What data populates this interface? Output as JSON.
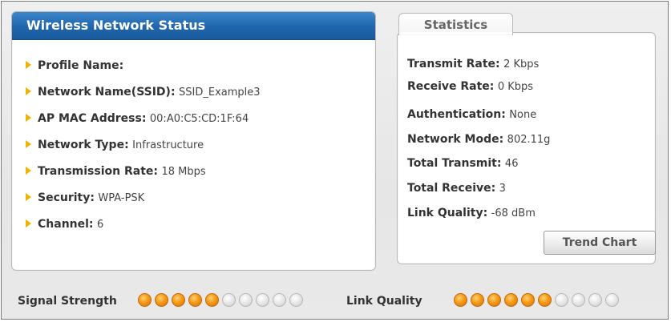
{
  "status": {
    "title": "Wireless Network Status",
    "items": [
      {
        "key": "Profile Name:",
        "value": ""
      },
      {
        "key": "Network Name(SSID):",
        "value": "SSID_Example3"
      },
      {
        "key": "AP MAC Address:",
        "value": "00:A0:C5:CD:1F:64"
      },
      {
        "key": "Network Type:",
        "value": "Infrastructure"
      },
      {
        "key": "Transmission Rate:",
        "value": "18 Mbps"
      },
      {
        "key": "Security:",
        "value": "WPA-PSK"
      },
      {
        "key": "Channel:",
        "value": "6"
      }
    ]
  },
  "statistics": {
    "tab_label": "Statistics",
    "items": [
      {
        "key": "Transmit Rate:",
        "value": "2 Kbps"
      },
      {
        "key": "Receive Rate:",
        "value": "0 Kbps"
      },
      {
        "key": "Authentication:",
        "value": "None"
      },
      {
        "key": "Network Mode:",
        "value": "802.11g"
      },
      {
        "key": "Total Transmit:",
        "value": "46"
      },
      {
        "key": "Total Receive:",
        "value": "3"
      },
      {
        "key": "Link Quality:",
        "value": "-68 dBm"
      }
    ],
    "trend_button": "Trend Chart"
  },
  "meters": {
    "signal_label": "Signal Strength",
    "signal_level": 5,
    "signal_total": 10,
    "link_label": "Link Quality",
    "link_level": 6,
    "link_total": 10
  },
  "colors": {
    "header_blue": "#1f66ae",
    "dot_on": "#f39a16",
    "dot_off": "#d4d4d4",
    "bullet": "#f2b200"
  }
}
